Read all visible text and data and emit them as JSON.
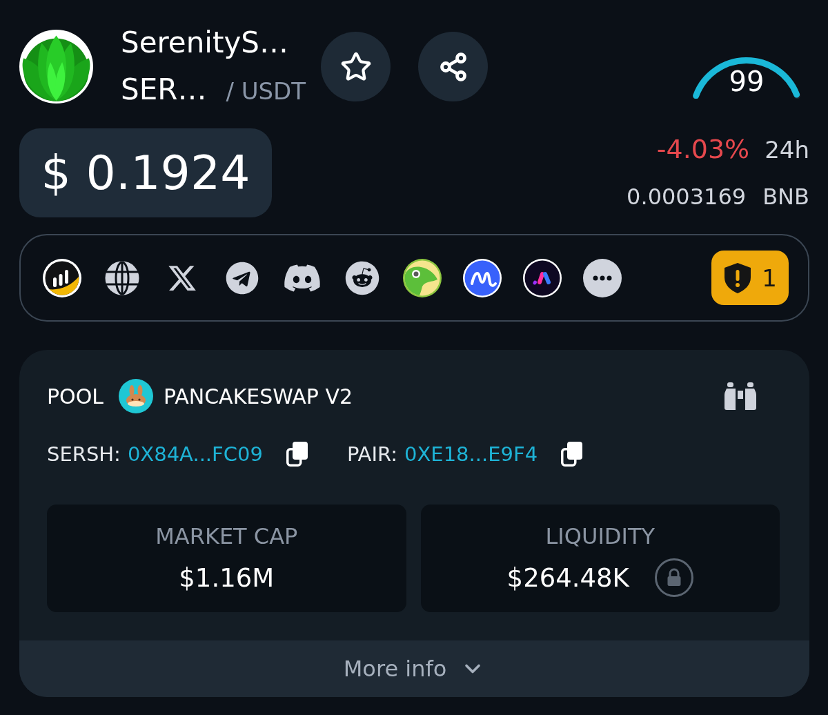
{
  "token": {
    "name": "SerenityS…",
    "symbol": "SER…",
    "quote": "/ USDT"
  },
  "score": {
    "value": "99",
    "level": 0.99
  },
  "price": {
    "usd": "$ 0.1924",
    "change": "-4.03%",
    "negative": true,
    "period": "24h",
    "native": "0.0003169",
    "native_unit": "BNB"
  },
  "security": {
    "warnings": "1"
  },
  "pool": {
    "label": "POOL",
    "dex": "PANCAKESWAP V2",
    "addresses": [
      {
        "label": "SERSH:",
        "value": "0X84A...FC09"
      },
      {
        "label": "PAIR:",
        "value": "0XE18...E9F4"
      }
    ],
    "stats": [
      {
        "label": "MARKET CAP",
        "value": "$1.16M",
        "locked": false
      },
      {
        "label": "LIQUIDITY",
        "value": "$264.48K",
        "locked": true
      }
    ],
    "more": "More info"
  }
}
